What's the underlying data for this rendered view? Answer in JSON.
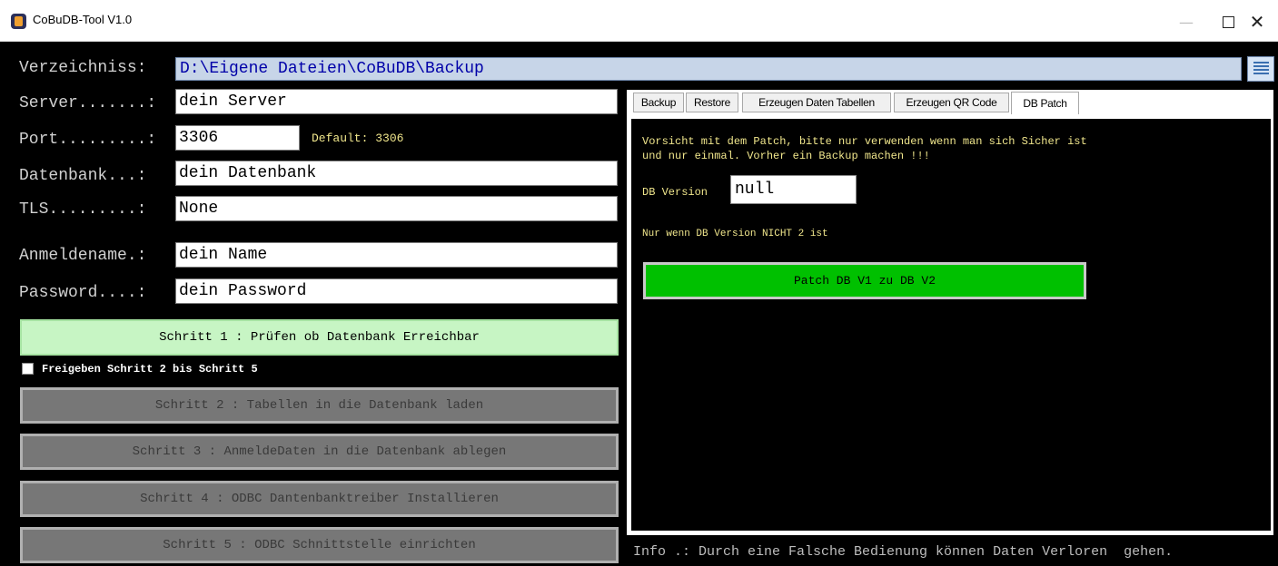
{
  "window": {
    "title": "CoBuDB-Tool V1.0",
    "minimize": "—",
    "close": "✕"
  },
  "form": {
    "directory_label": "Verzeichniss:",
    "directory_value": "D:\\Eigene Dateien\\CoBuDB\\Backup",
    "server_label": "Server.......:",
    "server_value": "dein Server",
    "port_label": "Port.........:",
    "port_value": "3306",
    "port_default": "Default: 3306",
    "database_label": "Datenbank...:",
    "database_value": "dein Datenbank",
    "tls_label": "TLS.........:",
    "tls_value": "None",
    "login_label": "Anmeldename.:",
    "login_value": "dein Name",
    "password_label": "Password....:",
    "password_value": "dein Password"
  },
  "steps": {
    "step1": "Schritt 1 : Prüfen ob Datenbank Erreichbar",
    "enable_label": "Freigeben Schritt 2 bis Schritt 5",
    "enable_checked": false,
    "step2": "Schritt 2 : Tabellen in die Datenbank laden",
    "step3": "Schritt 3 : AnmeldeDaten in die Datenbank ablegen",
    "step4": "Schritt 4 : ODBC Dantenbanktreiber Installieren",
    "step5": "Schritt 5 : ODBC Schnittstelle einrichten"
  },
  "tabs": [
    {
      "label": "Backup"
    },
    {
      "label": "Restore"
    },
    {
      "label": "Erzeugen Daten Tabellen"
    },
    {
      "label": "Erzeugen QR Code"
    },
    {
      "label": "DB Patch",
      "active": true
    }
  ],
  "patch": {
    "warning_line1": "Vorsicht mit dem Patch, bitte nur verwenden wenn man sich Sicher ist",
    "warning_line2": "und nur einmal. Vorher ein Backup machen !!!",
    "db_version_label": "DB Version",
    "db_version_value": "null",
    "note": "Nur wenn DB Version NICHT 2 ist",
    "button": "Patch DB V1 zu DB V2"
  },
  "info": "Info .: Durch eine Falsche Bedienung können Daten Verloren  gehen.",
  "colors": {
    "background": "#000000",
    "step1_bg": "#c7f5c4",
    "disabled_step_bg": "#777777",
    "patch_button_bg": "#00c000",
    "hint_text": "#f0e68c"
  }
}
